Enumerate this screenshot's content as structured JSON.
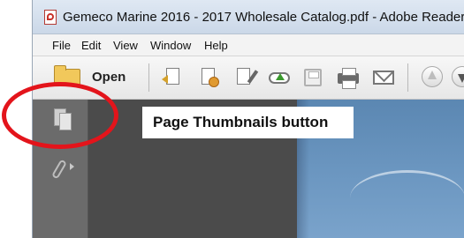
{
  "window": {
    "title": "Gemeco Marine 2016 - 2017 Wholesale Catalog.pdf - Adobe Reader",
    "title_icon": "pdf-icon"
  },
  "menu": {
    "items": [
      {
        "label": "File"
      },
      {
        "label": "Edit"
      },
      {
        "label": "View"
      },
      {
        "label": "Window"
      },
      {
        "label": "Help"
      }
    ]
  },
  "toolbar": {
    "open_label": "Open",
    "icons": [
      "folder-icon",
      "create-pdf-icon",
      "export-pdf-icon",
      "edit-icon",
      "cloud-upload-icon",
      "save-icon",
      "print-icon",
      "email-icon",
      "previous-page-icon",
      "next-page-icon"
    ]
  },
  "navpane": {
    "thumbnails_icon": "page-thumbnails-icon",
    "attachments_icon": "attachments-icon"
  },
  "annotation": {
    "callout_text": "Page Thumbnails button",
    "highlight_color": "#e3141b"
  }
}
